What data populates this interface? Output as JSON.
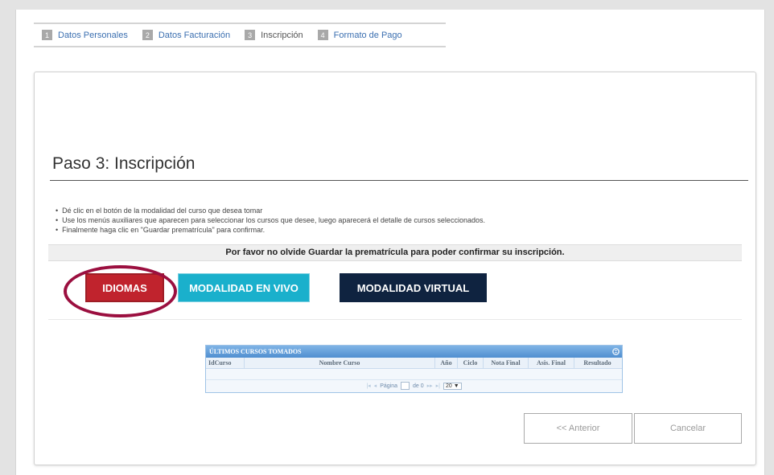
{
  "steps": [
    {
      "num": "1",
      "label": "Datos Personales"
    },
    {
      "num": "2",
      "label": "Datos Facturación"
    },
    {
      "num": "3",
      "label": "Inscripción"
    },
    {
      "num": "4",
      "label": "Formato de Pago"
    }
  ],
  "page_title": "Paso 3: Inscripción",
  "instructions": [
    "Dé clic en el botón de la modalidad del curso que desea tomar",
    "Use los menús auxiliares que aparecen para seleccionar los cursos que desee, luego aparecerá el detalle de cursos seleccionados.",
    "Finalmente haga clic en \"Guardar prematrícula\" para confirmar."
  ],
  "notice": "Por favor no olvide Guardar la prematrícula para poder confirmar su inscripción.",
  "modalities": {
    "idiomas": "IDIOMAS",
    "vivo": "MODALIDAD EN VIVO",
    "virtual": "MODALIDAD VIRTUAL"
  },
  "grid": {
    "caption": "ÚLTIMOS CURSOS TOMADOS",
    "columns": [
      "IdCurso",
      "Nombre Curso",
      "Año",
      "Ciclo",
      "Nota Final",
      "Asis. Final",
      "Resultado"
    ],
    "pager": {
      "page_label": "Página",
      "of_label": "de 0",
      "page_size": "20 ▼"
    }
  },
  "nav": {
    "anterior": "<< Anterior",
    "cancelar": "Cancelar"
  },
  "colors": {
    "idiomas": "#c0232d",
    "vivo": "#1ab0cc",
    "virtual": "#0f2340",
    "highlight": "#9b0f3f"
  }
}
